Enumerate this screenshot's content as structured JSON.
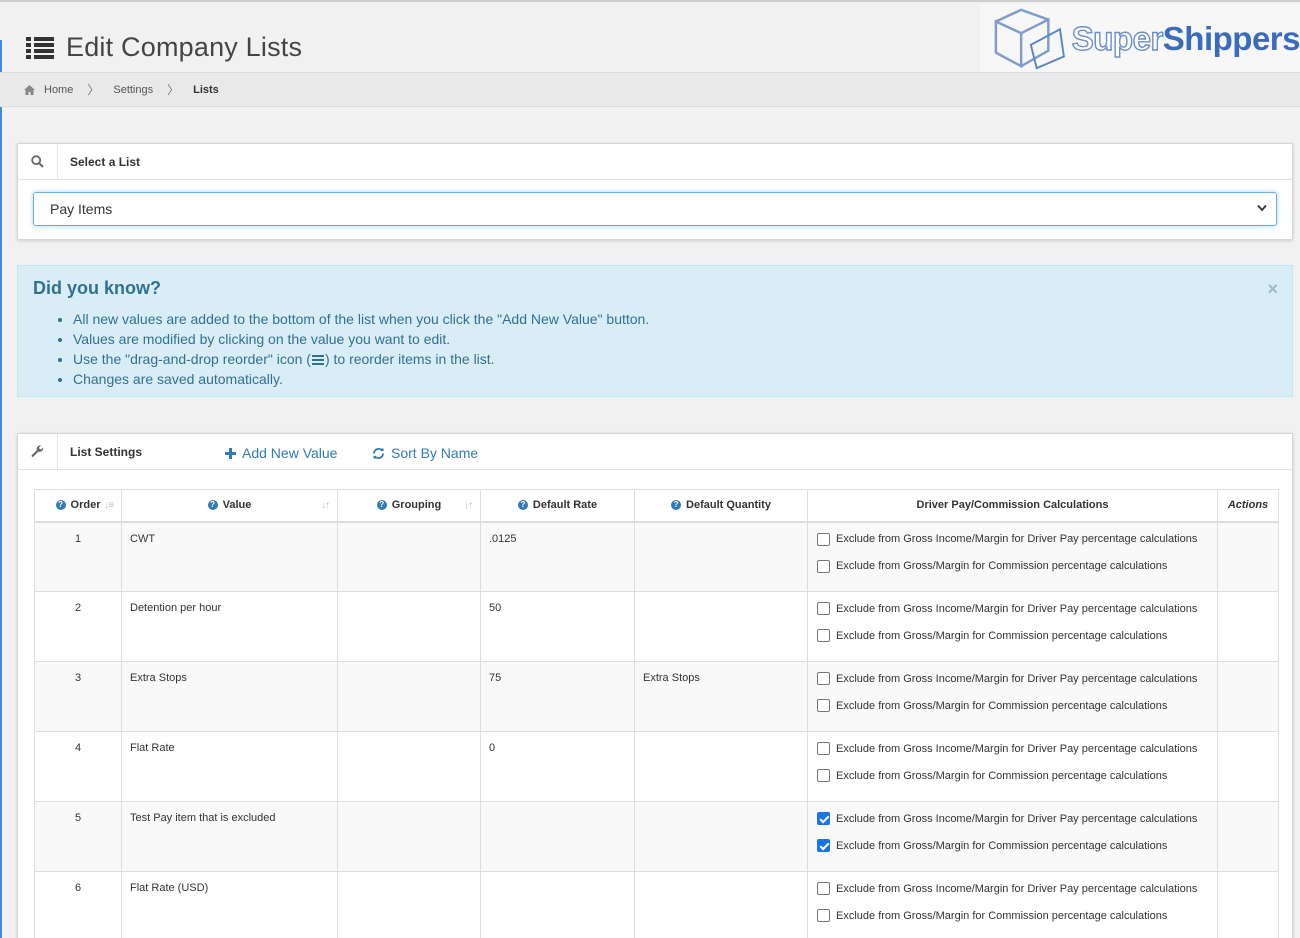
{
  "header": {
    "title": "Edit Company Lists",
    "logo": {
      "part1": "Super",
      "part2": "Shippers"
    }
  },
  "breadcrumb": {
    "items": [
      "Home",
      "Settings",
      "Lists"
    ]
  },
  "select_panel": {
    "title": "Select a List",
    "selected": "Pay Items"
  },
  "alert": {
    "title": "Did you know?",
    "close": "×",
    "items": [
      "All new values are added to the bottom of the list when you click the \"Add New Value\" button.",
      "Values are modified by clicking on the value you want to edit.",
      "Use the \"drag-and-drop reorder\" icon (",
      ") to reorder items in the list.",
      "Changes are saved automatically."
    ]
  },
  "list_settings": {
    "title": "List Settings",
    "add_label": "Add New Value",
    "sort_label": "Sort By Name"
  },
  "table": {
    "headers": {
      "order": "Order",
      "value": "Value",
      "grouping": "Grouping",
      "rate": "Default Rate",
      "qty": "Default Quantity",
      "driver": "Driver Pay/Commission Calculations",
      "actions": "Actions"
    },
    "check_labels": {
      "driver": "Exclude from Gross Income/Margin for Driver Pay percentage calculations",
      "commission": "Exclude from Gross/Margin for Commission percentage calculations"
    },
    "rows": [
      {
        "order": "1",
        "value": "CWT",
        "grouping": "",
        "rate": ".0125",
        "qty": "",
        "driver_checked": false,
        "commission_checked": false
      },
      {
        "order": "2",
        "value": "Detention per hour",
        "grouping": "",
        "rate": "50",
        "qty": "",
        "driver_checked": false,
        "commission_checked": false
      },
      {
        "order": "3",
        "value": "Extra Stops",
        "grouping": "",
        "rate": "75",
        "qty": "Extra Stops",
        "driver_checked": false,
        "commission_checked": false
      },
      {
        "order": "4",
        "value": "Flat Rate",
        "grouping": "",
        "rate": "0",
        "qty": "",
        "driver_checked": false,
        "commission_checked": false
      },
      {
        "order": "5",
        "value": "Test Pay item that is excluded",
        "grouping": "",
        "rate": "",
        "qty": "",
        "driver_checked": true,
        "commission_checked": true
      },
      {
        "order": "6",
        "value": "Flat Rate (USD)",
        "grouping": "",
        "rate": "",
        "qty": "",
        "driver_checked": false,
        "commission_checked": false
      }
    ]
  },
  "colors": {
    "link": "#337ab7",
    "alert_bg": "#d9edf7",
    "alert_text": "#31708f",
    "logo_blue": "#3b6bbd",
    "checkbox_on": "#1a73e8"
  }
}
